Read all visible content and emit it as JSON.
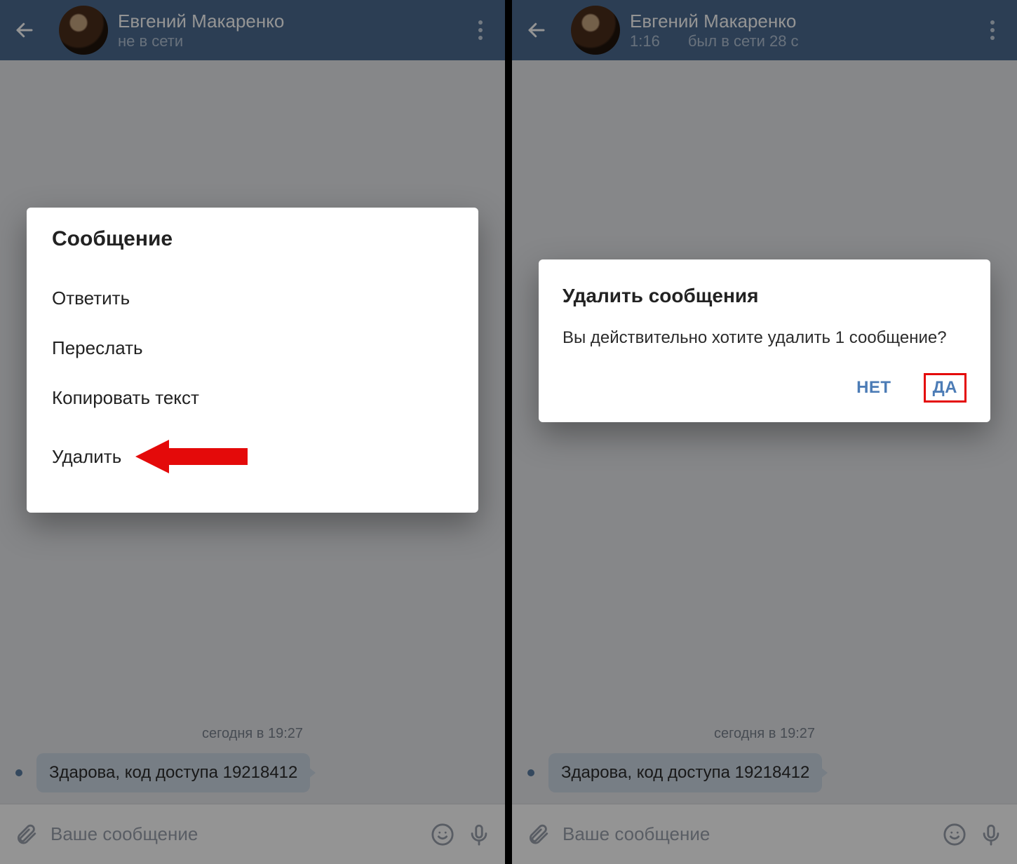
{
  "left": {
    "header": {
      "name": "Евгений Макаренко",
      "status": "не в сети"
    },
    "day_label": "сегодня в 19:27",
    "message_text": "Здарова, код доступа 19218412",
    "input_placeholder": "Ваше сообщение",
    "menu_dialog": {
      "title": "Сообщение",
      "reply": "Ответить",
      "forward": "Переслать",
      "copy": "Копировать текст",
      "delete": "Удалить"
    }
  },
  "right": {
    "header": {
      "name": "Евгений Макаренко",
      "time": "1:16",
      "status": "был в сети 28 с"
    },
    "day_label": "сегодня в 19:27",
    "message_text": "Здарова, код доступа 19218412",
    "input_placeholder": "Ваше сообщение",
    "confirm_dialog": {
      "title": "Удалить сообщения",
      "body": "Вы действительно хотите удалить 1 сообщение?",
      "no": "НЕТ",
      "yes": "ДА"
    }
  },
  "colors": {
    "accent": "#4c6c91",
    "link": "#4c7cb6",
    "danger": "#e40a0a"
  }
}
